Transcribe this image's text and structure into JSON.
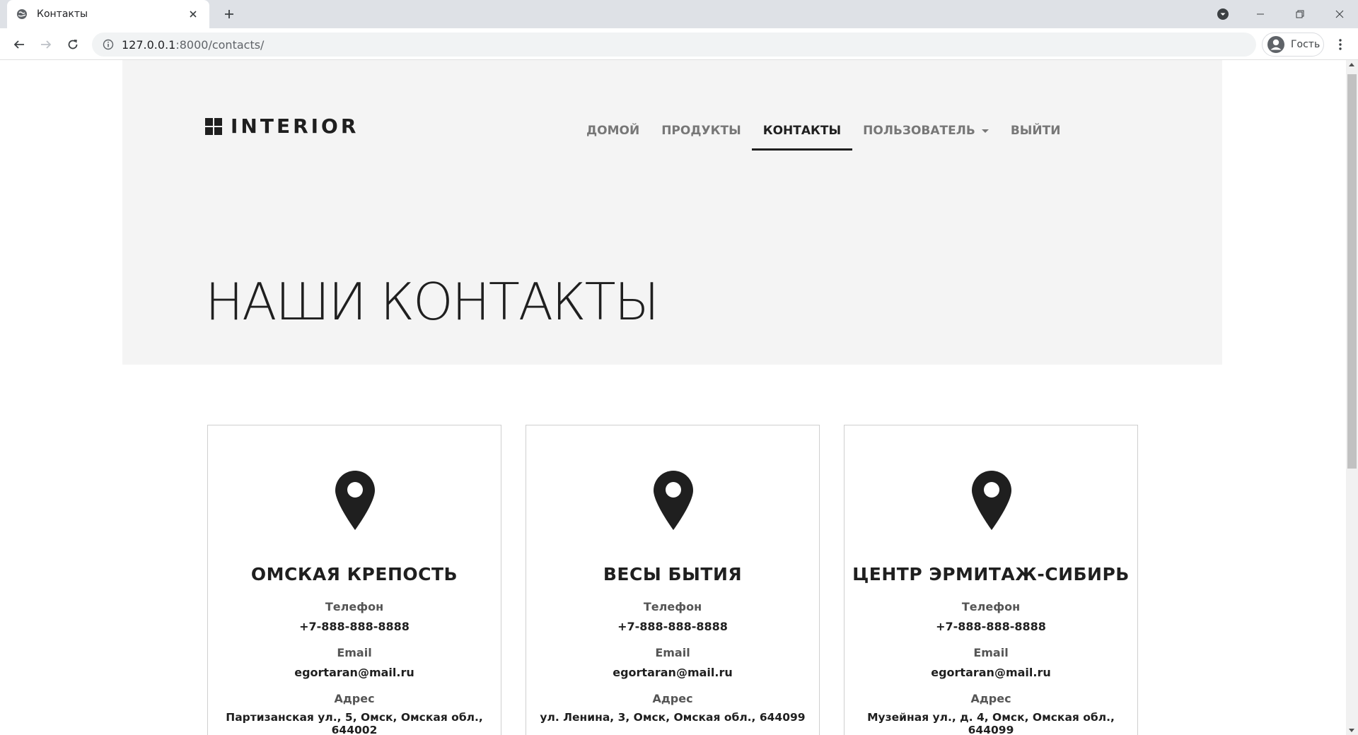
{
  "browser": {
    "tab_title": "Контакты",
    "url_host": "127.0.0.1",
    "url_path": ":8000/contacts/",
    "profile_label": "Гость"
  },
  "site": {
    "logo_text": "INTERIOR",
    "nav": [
      {
        "label": "ДОМОЙ",
        "active": false
      },
      {
        "label": "ПРОДУКТЫ",
        "active": false
      },
      {
        "label": "КОНТАКТЫ",
        "active": true
      },
      {
        "label": "ПОЛЬЗОВАТЕЛЬ",
        "active": false,
        "dropdown": true
      },
      {
        "label": "ВЫЙТИ",
        "active": false
      }
    ],
    "page_title": "НАШИ КОНТАКТЫ"
  },
  "contacts": {
    "phone_label": "Телефон",
    "email_label": "Email",
    "address_label": "Адрес",
    "cards": [
      {
        "name": "ОМСКАЯ КРЕПОСТЬ",
        "phone": "+7-888-888-8888",
        "email": "egortaran@mail.ru",
        "address": "Партизанская ул., 5, Омск, Омская обл., 644002",
        "icon": "map-pin-icon"
      },
      {
        "name": "ВЕСЫ БЫТИЯ",
        "phone": "+7-888-888-8888",
        "email": "egortaran@mail.ru",
        "address": "ул. Ленина, 3, Омск, Омская обл., 644099",
        "icon": "map-pin-icon"
      },
      {
        "name": "ЦЕНТР ЭРМИТАЖ-СИБИРЬ",
        "phone": "+7-888-888-8888",
        "email": "egortaran@mail.ru",
        "address": "Музейная ул., д. 4, Омск, Омская обл., 644099",
        "icon": "map-pin-icon"
      }
    ]
  },
  "colors": {
    "hero_bg": "#f4f4f4",
    "text_dark": "#1f1f1f",
    "nav_muted": "#777777",
    "chrome_tabbar": "#dee1e6"
  }
}
